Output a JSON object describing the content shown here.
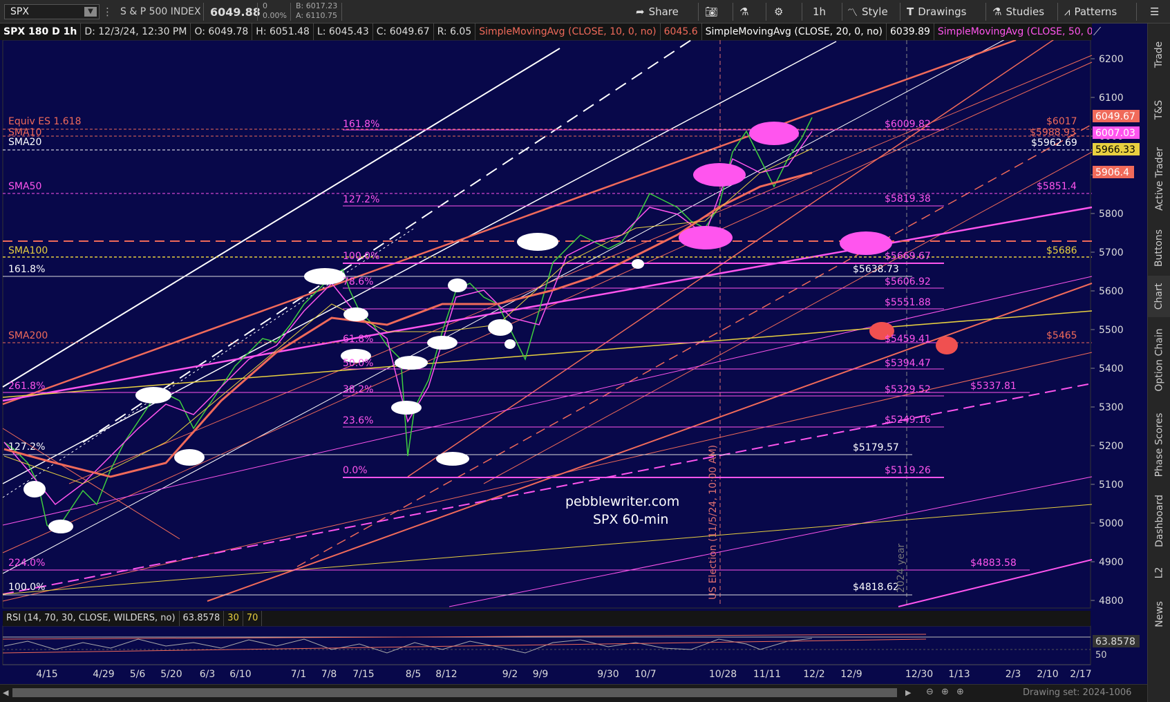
{
  "toolbar": {
    "symbol": "SPX",
    "symbol_name": "S & P 500 INDEX",
    "last_price": "6049.88",
    "net_change": "0",
    "pct_change": "0.00%",
    "bid": "B: 6017.23",
    "ask": "A: 6110.75",
    "share": "Share",
    "timeframe": "1h",
    "style": "Style",
    "drawings": "Drawings",
    "studies": "Studies",
    "patterns": "Patterns"
  },
  "infobar": {
    "title": "SPX 180 D 1h",
    "date": "D: 12/3/24, 12:30 PM",
    "open": "O: 6049.78",
    "high": "H: 6051.48",
    "low": "L: 6045.43",
    "close": "C: 6049.67",
    "range": "R: 6.05",
    "sma10": "SimpleMovingAvg (CLOSE, 10, 0, no)",
    "sma10_val": "6045.6",
    "sma20": "SimpleMovingAvg (CLOSE, 20, 0, no)",
    "sma20_val": "6039.89",
    "sma50": "SimpleMovingAvg (CLOSE, 50, 0,..."
  },
  "price_axis": {
    "ticks": [
      "6200",
      "6100",
      "6000",
      "5900",
      "5800",
      "5700",
      "5600",
      "5500",
      "5400",
      "5300",
      "5200",
      "5100",
      "5000",
      "4900",
      "4800"
    ],
    "badge_last": "6049.67",
    "badge_sma10": "6007.03",
    "badge_sma20": "5966.33",
    "badge_sma50": "5906.4",
    "rsi_value": "63.8578",
    "rsi_tick": "50"
  },
  "date_axis": [
    "4/15",
    "4/29",
    "5/6",
    "5/20",
    "6/3",
    "6/10",
    "7/1",
    "7/8",
    "7/15",
    "8/5",
    "8/12",
    "9/2",
    "9/9",
    "9/30",
    "10/7",
    "10/28",
    "11/11",
    "12/2",
    "12/9",
    "12/30",
    "1/13",
    "2/3",
    "2/10",
    "2/17"
  ],
  "left_labels": {
    "equiv": "Equiv ES 1.618",
    "sma10": "SMA10",
    "sma20": "SMA20",
    "sma50": "SMA50",
    "sma100": "SMA100",
    "sma200": "SMA200",
    "fib161": "161.8%",
    "fib261": "261.8%",
    "fib127": "127.2%",
    "fib224": "224.0%",
    "fib100": "100.0%"
  },
  "fib_labels": {
    "f1618": "161.8%",
    "f1272": "127.2%",
    "f100": "100.0%",
    "f786": "78.6%",
    "f618": "61.8%",
    "f50": "50.0%",
    "f382": "38.2%",
    "f236": "23.6%",
    "f0": "0.0%"
  },
  "right_labels": {
    "p6009": "$6009.82",
    "p6017": "$6017",
    "p5988": "$5988.93",
    "p5962": "$5962.69",
    "p5851": "$5851.4",
    "p5819": "$5819.38",
    "p5686": "$5686",
    "p5669": "$5669.67",
    "p5638": "$5638.73",
    "p5606": "$5606.92",
    "p5551": "$5551.88",
    "p5465": "$5465",
    "p5459": "$5459.41",
    "p5394": "$5394.47",
    "p5329": "$5329.52",
    "p5337": "$5337.81",
    "p5249": "$5249.16",
    "p5179": "$5179.57",
    "p5119": "$5119.26",
    "p4883": "$4883.58",
    "p4818": "$4818.62"
  },
  "annotations": {
    "watermark1": "pebblewriter.com",
    "watermark2": "SPX 60-min",
    "election": "US Election (11/5/24, 10:00 AM)",
    "year": "2024 year"
  },
  "rsi": {
    "label": "RSI (14, 70, 30, CLOSE, WILDERS, no)",
    "value": "63.8578",
    "ob": "30",
    "os": "70"
  },
  "sidebar": [
    "Trade",
    "T&S",
    "Active Trader",
    "Buttons",
    "Chart",
    "Option Chain",
    "Phase Scores",
    "Dashboard",
    "L2",
    "News"
  ],
  "footer": {
    "drawing_set": "Drawing set: 2024-1006"
  },
  "colors": {
    "background": "#08084a",
    "salmon": "#f06a5a",
    "magenta": "#ff55ee",
    "yellow": "#e8d040",
    "white": "#ffffff"
  }
}
